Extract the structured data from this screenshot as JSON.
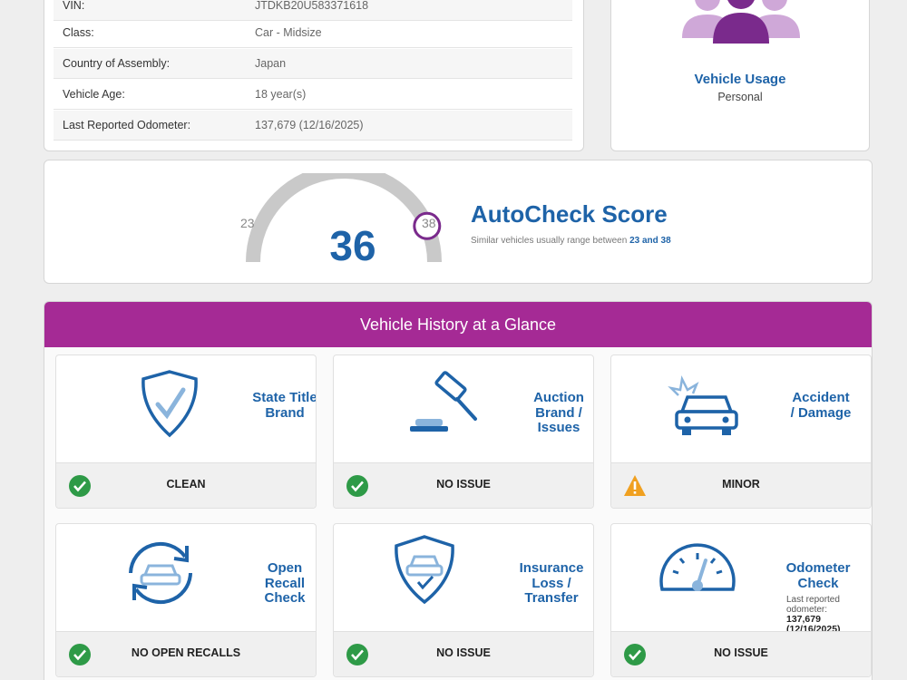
{
  "vehicle_info": {
    "rows": [
      {
        "label": "VIN:",
        "value": "JTDKB20U583371618"
      },
      {
        "label": "Class:",
        "value": "Car - Midsize"
      },
      {
        "label": "Country of Assembly:",
        "value": "Japan"
      },
      {
        "label": "Vehicle Age:",
        "value": "18 year(s)"
      },
      {
        "label": "Last Reported Odometer:",
        "value": "137,679 (12/16/2025)"
      }
    ]
  },
  "usage": {
    "title": "Vehicle Usage",
    "value": "Personal",
    "icon": "people-group-icon"
  },
  "score": {
    "title": "AutoCheck Score",
    "value": "36",
    "range_min": "23",
    "range_max": "38",
    "subtitle_prefix": "Similar vehicles usually range between",
    "subtitle_range": "23 and 38",
    "gauge_fraction": 0.87
  },
  "history": {
    "header": "Vehicle History at a Glance",
    "tiles": [
      {
        "label": "State Title Brand",
        "status": "CLEAN",
        "status_type": "ok",
        "icon": "shield-check-icon"
      },
      {
        "label": "Auction Brand / Issues",
        "status": "NO ISSUE",
        "status_type": "ok",
        "icon": "gavel-icon"
      },
      {
        "label": "Accident / Damage",
        "status": "MINOR",
        "status_type": "warning",
        "icon": "car-crash-icon"
      },
      {
        "label": "Open Recall Check",
        "status": "NO OPEN RECALLS",
        "status_type": "ok",
        "icon": "car-cycle-icon"
      },
      {
        "label": "Insurance Loss / Transfer",
        "status": "NO ISSUE",
        "status_type": "ok",
        "icon": "car-shield-icon"
      },
      {
        "label": "Odometer Check",
        "status": "NO ISSUE",
        "status_type": "ok",
        "icon": "odometer-icon",
        "note_line1": "Last reported",
        "note_line2": "odometer:",
        "note_value": "137,679",
        "note_date": "(12/16/2025)"
      }
    ]
  },
  "colors": {
    "brand_blue": "#1e63a8",
    "header_purple": "#a52a95",
    "ok_green": "#2e9a47",
    "warning_orange": "#f0a020",
    "usage_purple": "#7a2a8c"
  }
}
